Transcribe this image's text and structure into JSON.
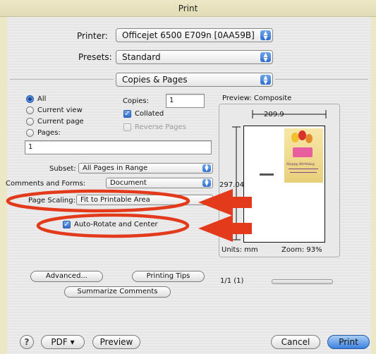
{
  "window": {
    "title": "Print"
  },
  "printer": {
    "label": "Printer:",
    "value": "Officejet 6500 E709n [0AA59B]"
  },
  "presets": {
    "label": "Presets:",
    "value": "Standard"
  },
  "section": {
    "value": "Copies & Pages"
  },
  "pages": {
    "options": [
      "All",
      "Current view",
      "Current page",
      "Pages:"
    ],
    "selected": "All",
    "pages_field_value": "1"
  },
  "copies": {
    "label": "Copies:",
    "value": "1",
    "collated_label": "Collated",
    "collated_checked": true,
    "reverse_label": "Reverse Pages",
    "reverse_checked": false
  },
  "subset": {
    "label": "Subset:",
    "value": "All Pages in Range"
  },
  "comments_forms": {
    "label": "Comments and Forms:",
    "value": "Document"
  },
  "page_scaling": {
    "label": "Page Scaling:",
    "value": "Fit to Printable Area"
  },
  "auto_rotate": {
    "label": "Auto-Rotate and Center",
    "checked": true
  },
  "preview": {
    "title": "Preview: Composite",
    "width_dim": "209.9",
    "height_dim": "297.04",
    "card_line1": "Happy Birthday",
    "units_label": "Units: mm",
    "zoom_label": "Zoom: 93%"
  },
  "buttons": {
    "advanced": "Advanced...",
    "printing_tips": "Printing Tips",
    "summarize": "Summarize Comments",
    "help": "?",
    "pdf": "PDF ▾",
    "preview": "Preview",
    "cancel": "Cancel",
    "print": "Print"
  },
  "page_count": "1/1 (1)",
  "colors": {
    "annotation": "#e23a1b",
    "accent": "#2f6ed1",
    "backdrop": "#ece7c5"
  }
}
